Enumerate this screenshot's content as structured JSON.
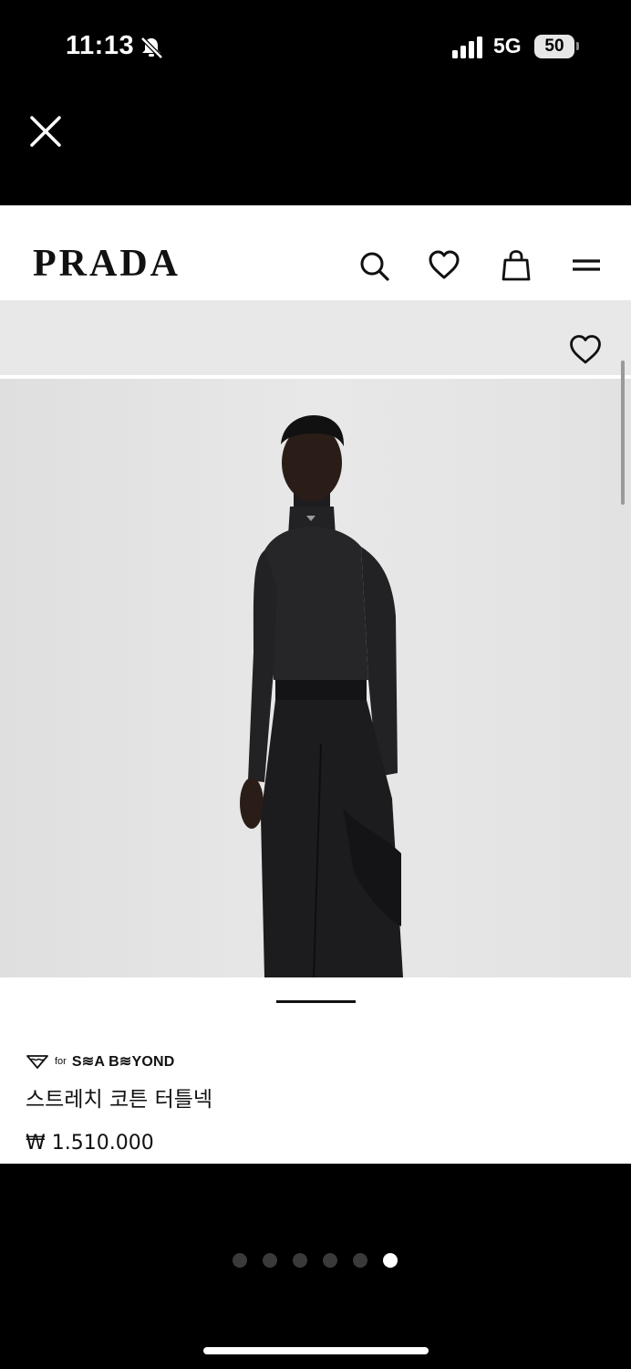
{
  "status_bar": {
    "time": "11:13",
    "network": "5G",
    "battery": "50"
  },
  "header": {
    "logo": "PRADA"
  },
  "product": {
    "brand_tag_for": "for",
    "brand_tag_name": "S≋A B≋YOND",
    "title": "스트레치 코튼 터틀넥",
    "price": "₩ 1.510.000"
  },
  "gallery": {
    "image_count": 5,
    "active_index": 1
  },
  "pager": {
    "count": 6,
    "active_index": 5
  },
  "colors": {
    "background": "#000000",
    "page": "#ffffff",
    "photo_bg": "#e4e4e4",
    "text": "#111111"
  },
  "icons": [
    "bell-slash-icon",
    "signal-icon",
    "close-icon",
    "search-icon",
    "heart-icon",
    "bag-icon",
    "menu-icon",
    "sea-beyond-icon"
  ]
}
